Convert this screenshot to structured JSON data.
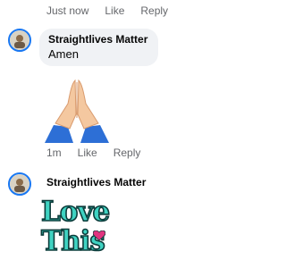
{
  "comment0": {
    "timestamp": "Just now",
    "like_label": "Like",
    "reply_label": "Reply"
  },
  "comment1": {
    "author": "Straightlives Matter",
    "text": "Amen",
    "emoji_icon": "folded-hands-icon",
    "timestamp": "1m",
    "like_label": "Like",
    "reply_label": "Reply"
  },
  "comment2": {
    "author": "Straightlives Matter",
    "sticker_line1": "Love",
    "sticker_line2": "This",
    "sticker_colors": {
      "fill": "#3fd3c2",
      "outline": "#0c3b3a",
      "heart": "#e0357f"
    }
  },
  "colors": {
    "avatar_ring": "#1877f2",
    "bubble_bg": "#f0f2f5",
    "meta_text": "#65676b"
  }
}
